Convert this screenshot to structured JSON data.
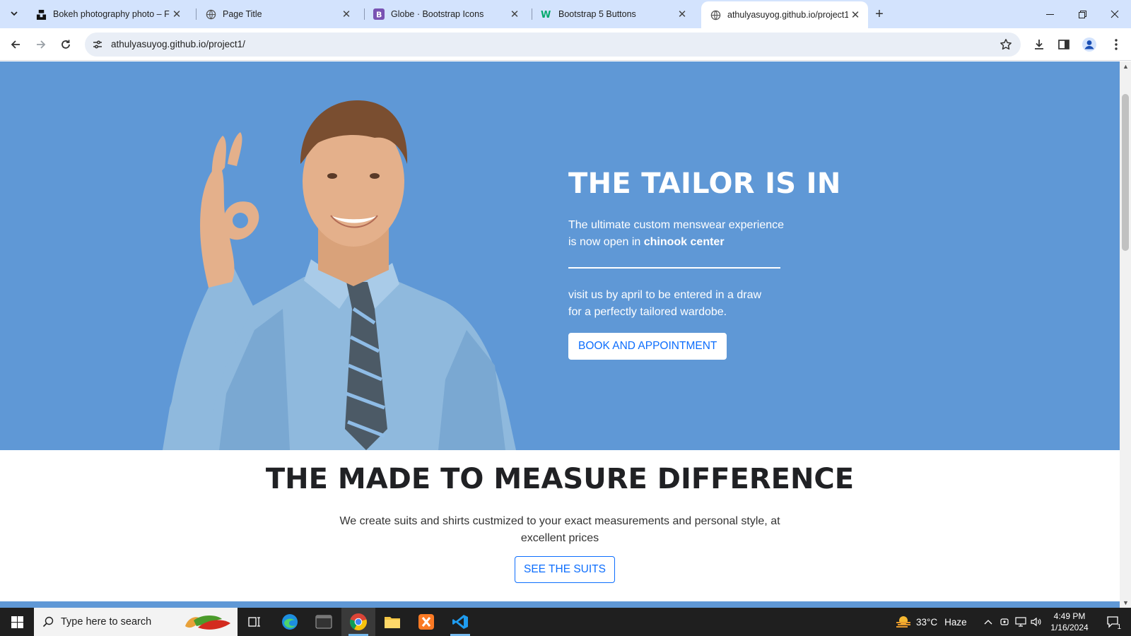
{
  "browser": {
    "tabs": [
      {
        "title": "Bokeh photography photo – Fr",
        "icon": "unsplash-icon"
      },
      {
        "title": "Page Title",
        "icon": "globe-icon"
      },
      {
        "title": "Globe · Bootstrap Icons",
        "icon": "bootstrap-icon"
      },
      {
        "title": "Bootstrap 5 Buttons",
        "icon": "w3schools-icon"
      },
      {
        "title": "athulyasuyog.github.io/project1",
        "icon": "globe-icon",
        "active": true
      }
    ],
    "address": "athulyasuyog.github.io/project1/"
  },
  "hero": {
    "title": "THE TAILOR IS IN",
    "line1": "The ultimate custom menswear experience",
    "line2_prefix": "is now open in ",
    "line2_bold": "chinook center",
    "visit1": "visit us by april to be entered in a draw",
    "visit2": "for a perfectly tailored wardobe.",
    "button": "BOOK AND APPOINTMENT",
    "background": "#5f98d6"
  },
  "difference": {
    "title": "THE MADE TO MEASURE DIFFERENCE",
    "text": "We create suits and shirts custmized to your exact measurements and personal style, at excellent prices",
    "button": "SEE THE SUITS",
    "accent": "#0d6efd"
  },
  "taskbar": {
    "search_placeholder": "Type here to search",
    "temperature": "33°C",
    "weather": "Haze",
    "time": "4:49 PM",
    "date": "1/16/2024",
    "notification_count": "1"
  }
}
